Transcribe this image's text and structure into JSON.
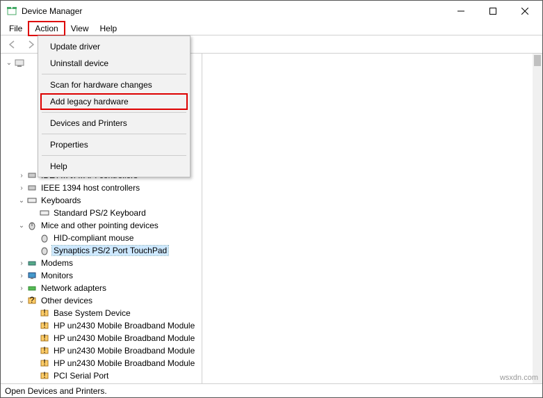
{
  "window": {
    "title": "Device Manager"
  },
  "menubar": [
    "File",
    "Action",
    "View",
    "Help"
  ],
  "action_menu": {
    "update": "Update driver",
    "uninstall": "Uninstall device",
    "scan": "Scan for hardware changes",
    "add_legacy": "Add legacy hardware",
    "dev_printers": "Devices and Printers",
    "properties": "Properties",
    "help": "Help"
  },
  "tree": {
    "ide": "IDE ATA/ATAPI controllers",
    "ieee": "IEEE 1394 host controllers",
    "keyboards": "Keyboards",
    "kbd0": "Standard PS/2 Keyboard",
    "mice": "Mice and other pointing devices",
    "mouse0": "HID-compliant mouse",
    "mouse1": "Synaptics PS/2 Port TouchPad",
    "modems": "Modems",
    "monitors": "Monitors",
    "netadapters": "Network adapters",
    "other": "Other devices",
    "other0": "Base System Device",
    "other1": "HP un2430 Mobile Broadband Module",
    "other2": "HP un2430 Mobile Broadband Module",
    "other3": "HP un2430 Mobile Broadband Module",
    "other4": "HP un2430 Mobile Broadband Module",
    "other5": "PCI Serial Port"
  },
  "statusbar": "Open Devices and Printers.",
  "watermark": "wsxdn.com"
}
